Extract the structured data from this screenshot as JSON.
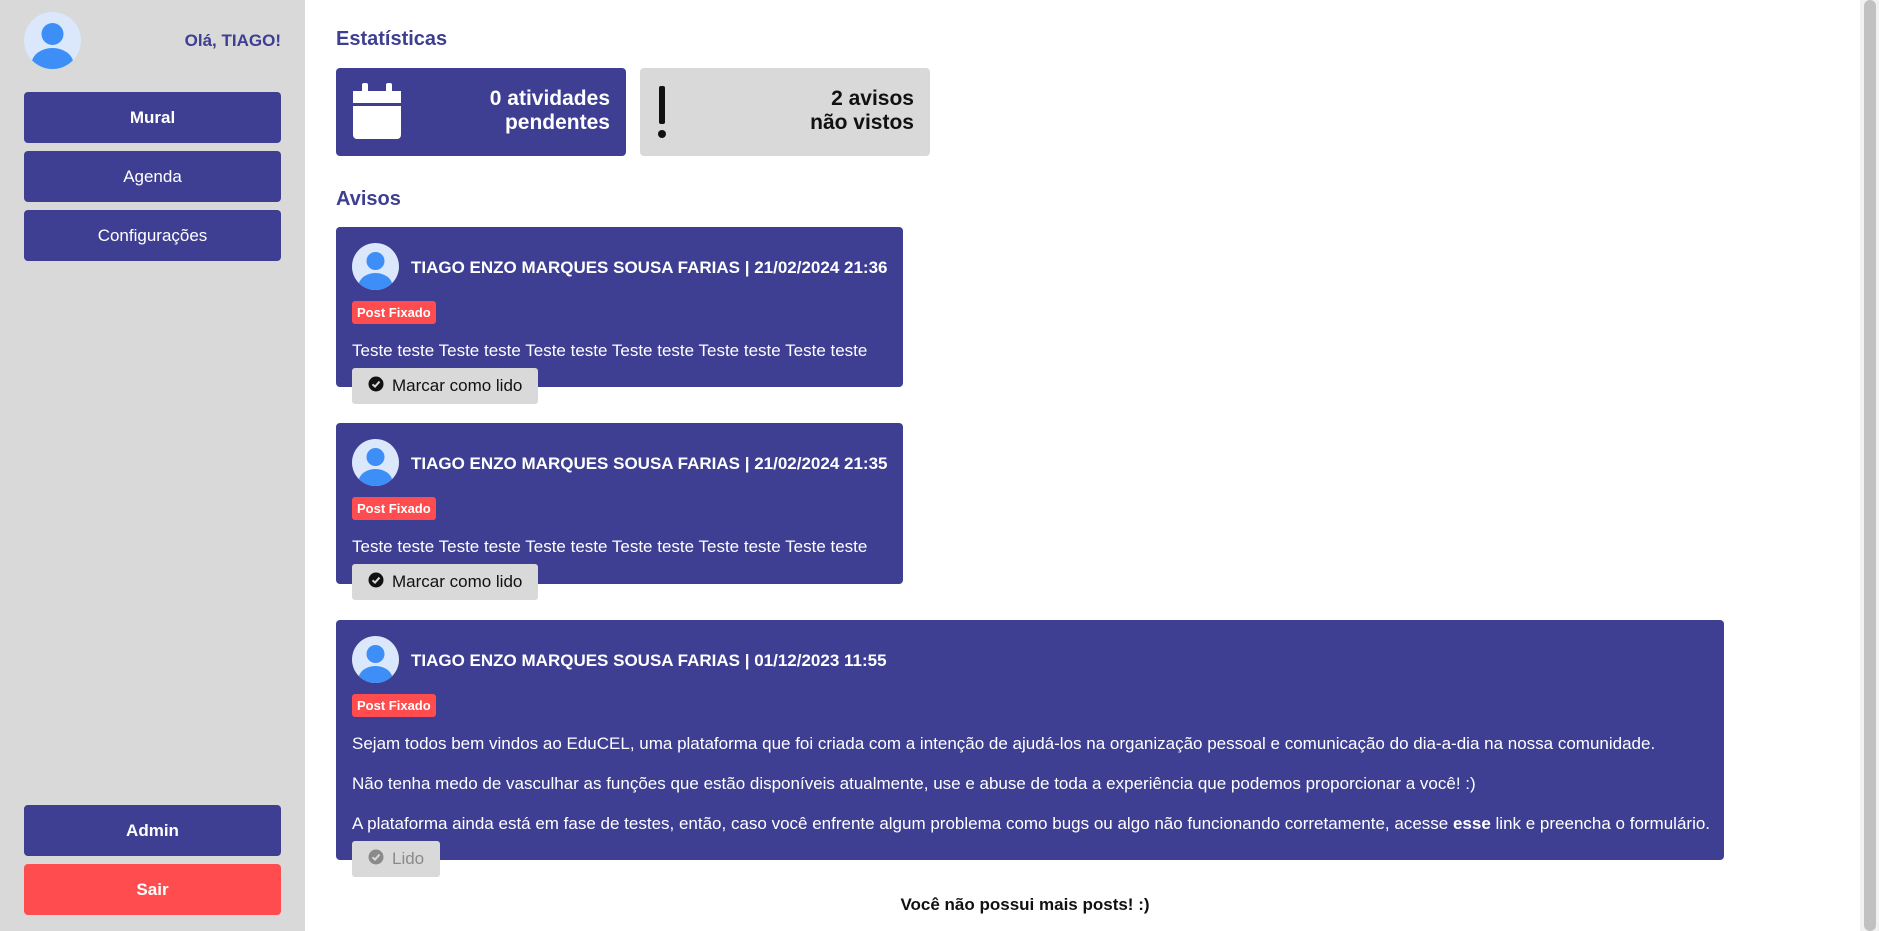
{
  "sidebar": {
    "greeting": "Olá, TIAGO!",
    "menu": {
      "mural": "Mural",
      "agenda": "Agenda",
      "config": "Configurações"
    },
    "admin": "Admin",
    "logout": "Sair"
  },
  "stats": {
    "title": "Estatísticas",
    "activities": {
      "line1": "0 atividades",
      "line2": "pendentes"
    },
    "notices": {
      "line1": "2 avisos",
      "line2": "não vistos"
    }
  },
  "avisos": {
    "title": "Avisos",
    "badge": "Post Fixado",
    "posts": [
      {
        "header": "TIAGO ENZO MARQUES SOUSA FARIAS | 21/02/2024 21:36",
        "body": [
          "Teste teste Teste teste Teste teste Teste teste Teste teste Teste teste"
        ],
        "action": "Marcar como lido"
      },
      {
        "header": "TIAGO ENZO MARQUES SOUSA FARIAS | 21/02/2024 21:35",
        "body": [
          "Teste teste Teste teste Teste teste Teste teste Teste teste Teste teste"
        ],
        "action": "Marcar como lido"
      },
      {
        "header": "TIAGO ENZO MARQUES SOUSA FARIAS | 01/12/2023 11:55",
        "body": [
          "Sejam todos bem vindos ao EduCEL, uma plataforma que foi criada com a intenção de ajudá-los na organização pessoal e comunicação do dia-a-dia na nossa comunidade.",
          "Não tenha medo de vasculhar as funções que estão disponíveis atualmente, use e abuse de toda a experiência que podemos proporcionar a você! :)"
        ],
        "body3": {
          "before": "A plataforma ainda está em fase de testes, então, caso você enfrente algum problema como bugs ou algo não funcionando corretamente, acesse ",
          "link": "esse",
          "after": " link e preencha o formulário."
        },
        "action": "Lido"
      }
    ],
    "end_message": "Você não possui mais posts! :)"
  },
  "colors": {
    "primary": "#3e3e93",
    "danger": "#ff4d4f",
    "neutral": "#d9d9d9"
  }
}
